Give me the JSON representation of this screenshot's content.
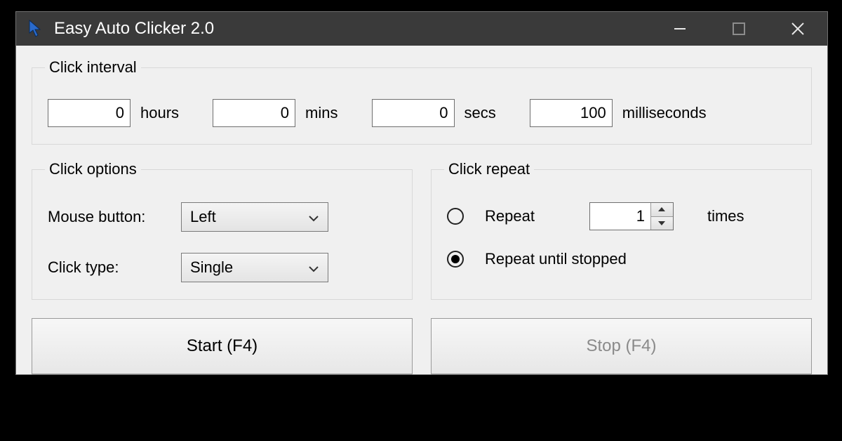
{
  "window": {
    "title": "Easy Auto Clicker 2.0"
  },
  "interval": {
    "legend": "Click interval",
    "hours": {
      "value": "0",
      "label": "hours"
    },
    "mins": {
      "value": "0",
      "label": "mins"
    },
    "secs": {
      "value": "0",
      "label": "secs"
    },
    "ms": {
      "value": "100",
      "label": "milliseconds"
    }
  },
  "options": {
    "legend": "Click options",
    "mouse_button_label": "Mouse button:",
    "mouse_button_value": "Left",
    "click_type_label": "Click type:",
    "click_type_value": "Single"
  },
  "repeat": {
    "legend": "Click repeat",
    "repeat_label": "Repeat",
    "repeat_count": "1",
    "times_label": "times",
    "repeat_until_label": "Repeat until stopped",
    "selected": "until_stopped"
  },
  "actions": {
    "start_label": "Start (F4)",
    "stop_label": "Stop (F4)"
  }
}
